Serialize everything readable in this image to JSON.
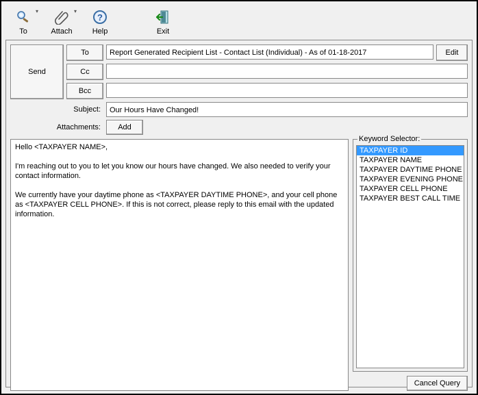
{
  "toolbar": {
    "to": "To",
    "attach": "Attach",
    "help": "Help",
    "exit": "Exit"
  },
  "buttons": {
    "send": "Send",
    "to": "To",
    "cc": "Cc",
    "bcc": "Bcc",
    "edit": "Edit",
    "add": "Add",
    "cancel_query": "Cancel Query"
  },
  "labels": {
    "subject": "Subject:",
    "attachments": "Attachments:",
    "keyword_selector": "Keyword Selector:"
  },
  "fields": {
    "to": "Report Generated Recipient List - Contact List (Individual) - As of 01-18-2017",
    "cc": "",
    "bcc": "",
    "subject": "Our Hours Have Changed!"
  },
  "body": "Hello <TAXPAYER NAME>,\n\nI'm reaching out to you to let you know our hours have changed. We also needed to verify your contact information.\n\nWe currently have your daytime phone as <TAXPAYER DAYTIME PHONE>, and your cell phone as <TAXPAYER CELL PHONE>. If this is not correct, please reply to this email with the updated information.",
  "keywords": {
    "items": [
      "TAXPAYER ID",
      "TAXPAYER NAME",
      "TAXPAYER DAYTIME PHONE",
      "TAXPAYER EVENING PHONE",
      "TAXPAYER CELL PHONE",
      "TAXPAYER BEST CALL TIME"
    ],
    "selected_index": 0
  }
}
